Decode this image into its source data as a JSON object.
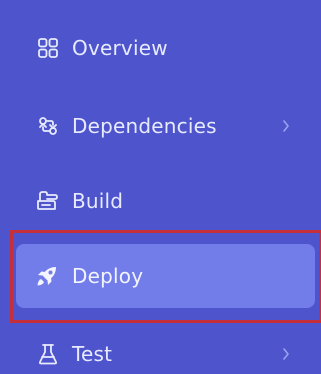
{
  "sidebar": {
    "items": [
      {
        "label": "Overview",
        "icon": "grid-icon",
        "has_chevron": false,
        "active": false
      },
      {
        "label": "Dependencies",
        "icon": "dependencies-icon",
        "has_chevron": true,
        "active": false
      },
      {
        "label": "Build",
        "icon": "build-icon",
        "has_chevron": false,
        "active": false
      },
      {
        "label": "Deploy",
        "icon": "rocket-icon",
        "has_chevron": false,
        "active": true
      },
      {
        "label": "Test",
        "icon": "flask-icon",
        "has_chevron": true,
        "active": false
      }
    ]
  },
  "colors": {
    "sidebar_background": "#4e55cc",
    "active_item_background": "#727dea",
    "active_item_highlight_border": "#c32f3a",
    "text_color": "#e8eaff"
  }
}
